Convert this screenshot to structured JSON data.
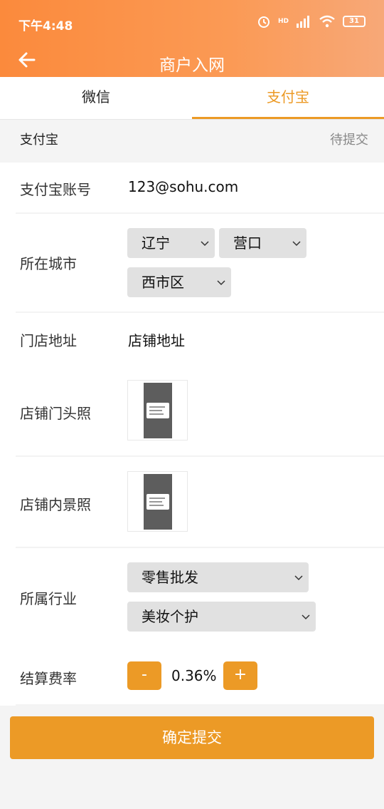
{
  "status_bar": {
    "time": "下午4:48",
    "network": "HD",
    "battery": "31"
  },
  "header": {
    "title": "商户入网"
  },
  "tabs": [
    {
      "label": "微信",
      "active": false
    },
    {
      "label": "支付宝",
      "active": true
    }
  ],
  "section": {
    "label": "支付宝",
    "status": "待提交"
  },
  "form": {
    "account": {
      "label": "支付宝账号",
      "value": "123@sohu.com"
    },
    "city": {
      "label": "所在城市",
      "province": "辽宁",
      "city": "营口",
      "district": "西市区"
    },
    "address": {
      "label": "门店地址",
      "value": "店铺地址"
    },
    "front_photo": {
      "label": "店铺门头照"
    },
    "inner_photo": {
      "label": "店铺内景照"
    },
    "industry": {
      "label": "所属行业",
      "category": "零售批发",
      "subcategory": "美妆个护"
    },
    "rate": {
      "label": "结算费率",
      "minus": "-",
      "value": "0.36%",
      "plus": "+"
    }
  },
  "submit_label": "确定提交",
  "colors": {
    "accent": "#ec9a26",
    "header_start": "#fb8a3c",
    "header_end": "#f7a878"
  }
}
